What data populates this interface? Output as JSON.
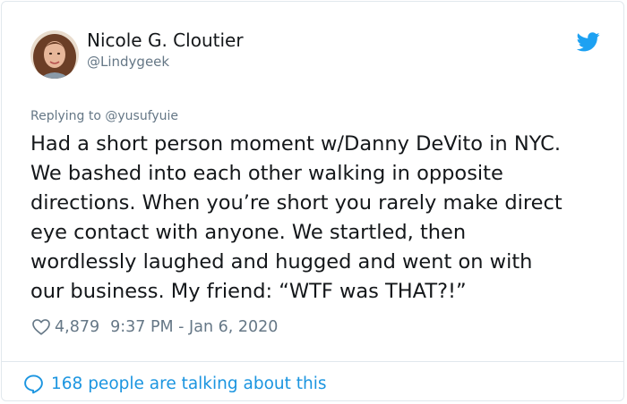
{
  "author": {
    "name": "Nicole G. Cloutier",
    "handle": "@Lindygeek",
    "avatar_icon": "avatar-photo"
  },
  "tweet": {
    "reply_to": "Replying to @yusufyuie",
    "lines": [
      "Had a short person moment w/Danny DeVito in NYC.",
      "We bashed into each other walking in opposite",
      "directions. When you’re short you rarely make direct",
      "eye contact with anyone. We startled, then",
      "wordlessly laughed and hugged and went on with",
      "our business. My friend: “WTF was THAT?!”"
    ],
    "like_count": "4,879",
    "timestamp": "9:37 PM - Jan 6, 2020"
  },
  "footer": {
    "talking_text": "168 people are talking about this"
  },
  "icons": {
    "brand": "twitter-bird-icon",
    "like": "heart-icon",
    "comment": "speech-bubble-icon"
  },
  "colors": {
    "brand_blue": "#1da1f2",
    "link_blue": "#1b95e0",
    "text_primary": "#14171a",
    "text_secondary": "#657786",
    "border": "#e1e8ed"
  }
}
